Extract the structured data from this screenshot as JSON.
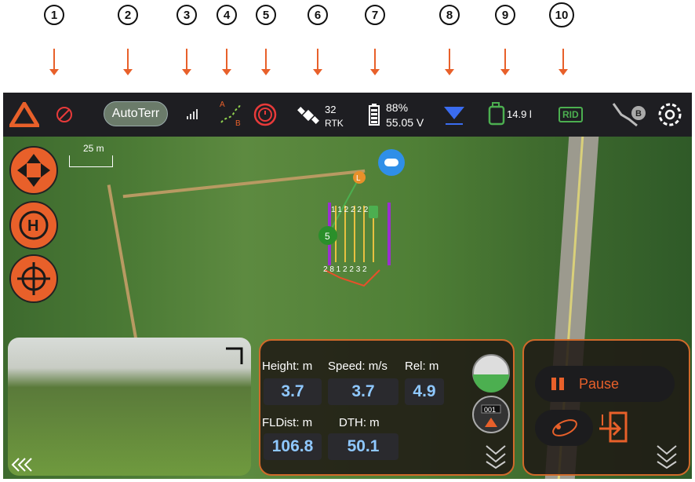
{
  "callouts": [
    "1",
    "2",
    "3",
    "4",
    "5",
    "6",
    "7",
    "8",
    "9",
    "10"
  ],
  "topbar": {
    "autoterr_label": "AutoTerr",
    "satellites": "32",
    "rtk_label": "RTK",
    "battery_percent": "88%",
    "battery_voltage": "55.05 V",
    "fuel": "14.9 l",
    "rid_label": "RID",
    "route_marker": "B"
  },
  "map": {
    "scale_label": "25 m",
    "home_marker": "L",
    "waypoint_label": "5",
    "route_numbers_top": "1 1 2 2 2 2",
    "route_numbers_bottom": "2 8 1 2 2 3 2"
  },
  "telemetry": {
    "height_label": "Height: m",
    "height_value": "3.7",
    "speed_label": "Speed: m/s",
    "speed_value": "3.7",
    "rel_label": "Rel: m",
    "rel_value": "4.9",
    "fldist_label": "FLDist: m",
    "fldist_value": "106.8",
    "dth_label": "DTH: m",
    "dth_value": "50.1",
    "heading_readout": "001"
  },
  "mission": {
    "pause_label": "Pause"
  },
  "colors": {
    "accent": "#e8602a",
    "value_text": "#8fc8ff",
    "topbar_bg": "#1e1e22"
  }
}
